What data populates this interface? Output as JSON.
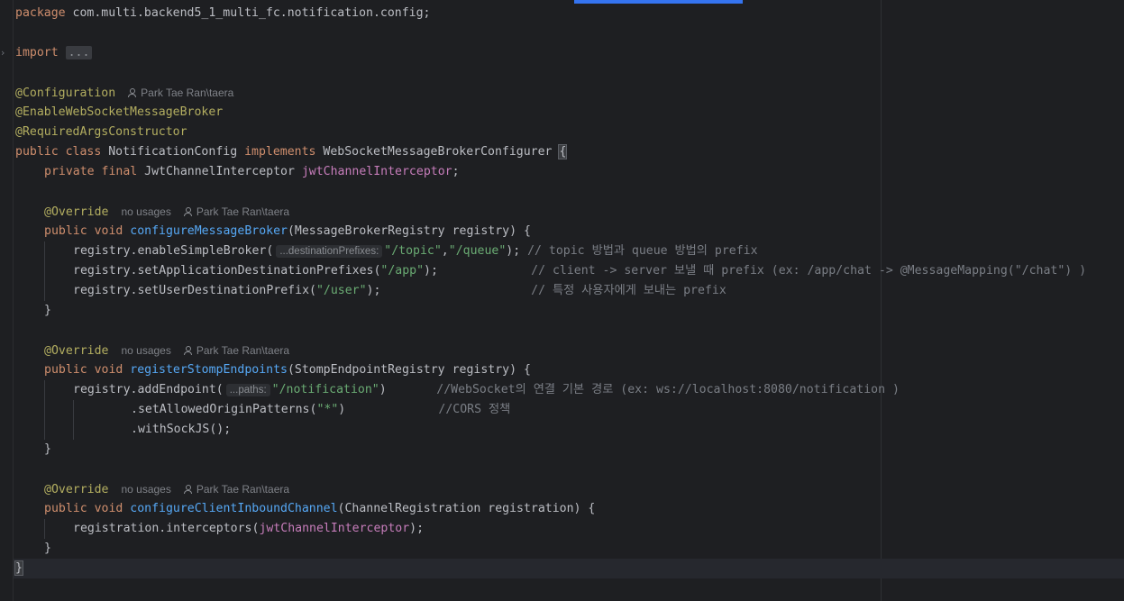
{
  "editor": {
    "theme": {
      "background": "#1e1f22",
      "keyword": "#cf8e6d",
      "annotation": "#b3ae60",
      "string": "#6aab73",
      "method": "#56a8f5",
      "field": "#c77dbb",
      "comment": "#7a7e85",
      "accent": "#3574f0"
    },
    "code": {
      "package_kw": "package",
      "package_name": " com.multi.backend5_1_multi_fc.notification.config;",
      "import_kw": "import",
      "import_folded": "...",
      "ann_configuration": "@Configuration",
      "author": "Park Tae Ran\\taera",
      "ann_enable_ws": "@EnableWebSocketMessageBroker",
      "ann_required_args": "@RequiredArgsConstructor",
      "class_decl": {
        "public_kw": "public",
        "class_kw": " class",
        "class_name": " NotificationConfig ",
        "implements_kw": "implements",
        "iface": " WebSocketMessageBrokerConfigurer ",
        "brace": "{"
      },
      "field_decl": {
        "modifiers": "private final",
        "type": " JwtChannelInterceptor ",
        "name": "jwtChannelInterceptor",
        "end": ";"
      },
      "override": "@Override",
      "no_usages": "no usages",
      "public_void": "public void ",
      "m1": {
        "name": "configureMessageBroker",
        "params": "(MessageBrokerRegistry registry) {",
        "l1_call": "registry.enableSimpleBroker(",
        "l1_hint": "...destinationPrefixes:",
        "l1_s1": "\"/topic\"",
        "l1_comma": ",",
        "l1_s2": "\"/queue\"",
        "l1_end": "); ",
        "l1_comment": "// topic 방법과 queue 방법의 prefix",
        "l2_call": "registry.setApplicationDestinationPrefixes(",
        "l2_s": "\"/app\"",
        "l2_end": ");             ",
        "l2_comment": "// client -> server 보낼 때 prefix (ex: /app/chat -> @MessageMapping(\"/chat\") )",
        "l3_call": "registry.setUserDestinationPrefix(",
        "l3_s": "\"/user\"",
        "l3_end": ");                     ",
        "l3_comment": "// 특정 사용자에게 보내는 prefix"
      },
      "m2": {
        "name": "registerStompEndpoints",
        "params": "(StompEndpointRegistry registry) {",
        "l1_call": "registry.addEndpoint(",
        "l1_hint": "...paths:",
        "l1_s": "\"/notification\"",
        "l1_end": ")       ",
        "l1_comment": "//WebSocket의 연결 기본 경로 (ex: ws://localhost:8080/notification )",
        "l2_call": ".setAllowedOriginPatterns(",
        "l2_s": "\"*\"",
        "l2_end": ")             ",
        "l2_comment": "//CORS 정책",
        "l3_call": ".withSockJS();"
      },
      "m3": {
        "name": "configureClientInboundChannel",
        "params": "(ChannelRegistration registration) {",
        "l1_call": "registration.interceptors(",
        "l1_field": "jwtChannelInterceptor",
        "l1_end": ");"
      },
      "close_brace": "}"
    }
  }
}
